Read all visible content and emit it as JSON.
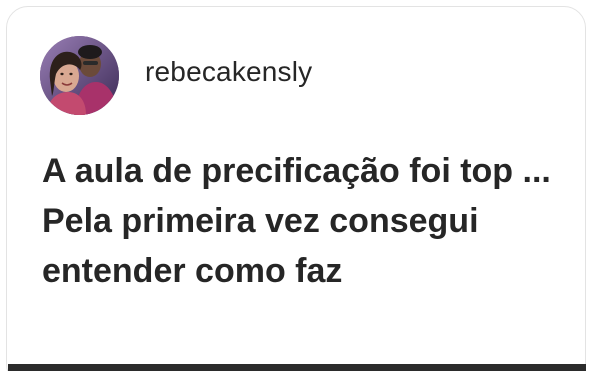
{
  "post": {
    "username": "rebecakensly",
    "avatar_icon": "profile-photo",
    "comment_text": "A aula de precificação foi top ... Pela primeira vez consegui entender como faz"
  },
  "colors": {
    "text": "#262626",
    "card_border": "#e3e3e3",
    "bottom_bar": "#2b2b2b"
  }
}
